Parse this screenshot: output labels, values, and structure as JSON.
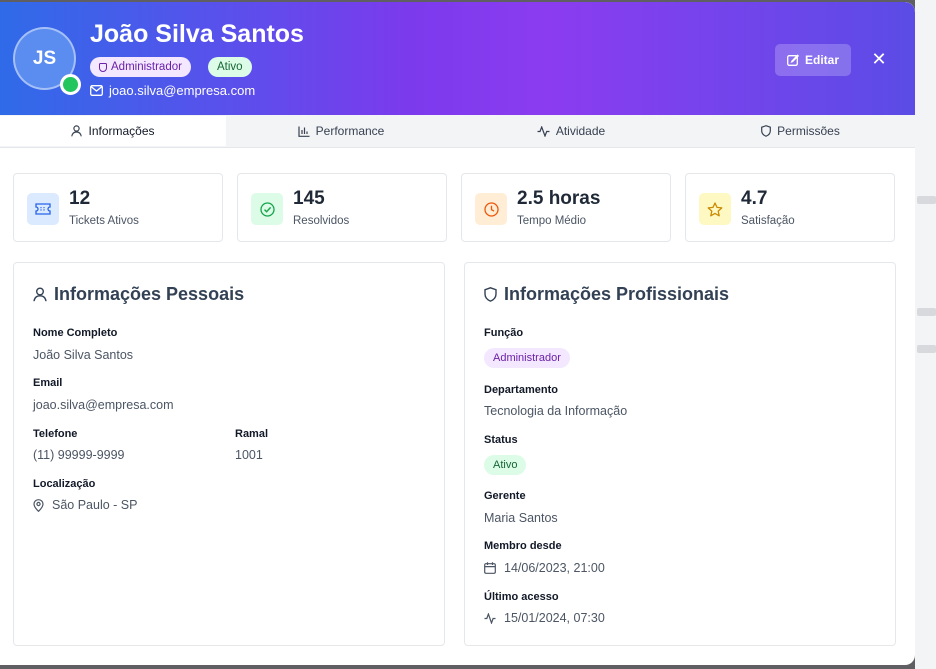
{
  "user": {
    "initials": "JS",
    "name": "João Silva Santos",
    "role": "Administrador",
    "status": "Ativo",
    "email": "joao.silva@empresa.com"
  },
  "header": {
    "edit_label": "Editar",
    "close_glyph": "✕"
  },
  "tabs": [
    {
      "label": "Informações",
      "icon": "user-icon"
    },
    {
      "label": "Performance",
      "icon": "bar-chart-icon"
    },
    {
      "label": "Atividade",
      "icon": "activity-icon"
    },
    {
      "label": "Permissões",
      "icon": "shield-icon"
    }
  ],
  "stats": [
    {
      "value": "12",
      "label": "Tickets Ativos",
      "icon": "ticket-icon",
      "color": "#2563eb",
      "bg": "#dbeafe"
    },
    {
      "value": "145",
      "label": "Resolvidos",
      "icon": "check-circle-icon",
      "color": "#16a34a",
      "bg": "#dcfce7"
    },
    {
      "value": "2.5 horas",
      "label": "Tempo Médio",
      "icon": "clock-icon",
      "color": "#ea580c",
      "bg": "#ffedd5"
    },
    {
      "value": "4.7",
      "label": "Satisfação",
      "icon": "star-icon",
      "color": "#ca8a04",
      "bg": "#fef9c3"
    }
  ],
  "personal": {
    "title": "Informações Pessoais",
    "full_name_label": "Nome Completo",
    "full_name": "João Silva Santos",
    "email_label": "Email",
    "email": "joao.silva@empresa.com",
    "phone_label": "Telefone",
    "phone": "(11) 99999-9999",
    "extension_label": "Ramal",
    "extension": "1001",
    "location_label": "Localização",
    "location": "São Paulo - SP"
  },
  "professional": {
    "title": "Informações Profissionais",
    "role_label": "Função",
    "role": "Administrador",
    "department_label": "Departamento",
    "department": "Tecnologia da Informação",
    "status_label": "Status",
    "status": "Ativo",
    "manager_label": "Gerente",
    "manager": "Maria Santos",
    "member_since_label": "Membro desde",
    "member_since": "14/06/2023, 21:00",
    "last_access_label": "Último acesso",
    "last_access": "15/01/2024, 07:30"
  },
  "colors": {
    "role_badge_bg": "#f3e8ff",
    "role_badge_text": "#6b21a8",
    "status_badge_bg": "#dcfce7",
    "status_badge_text": "#166534",
    "online": "#22c55e"
  }
}
